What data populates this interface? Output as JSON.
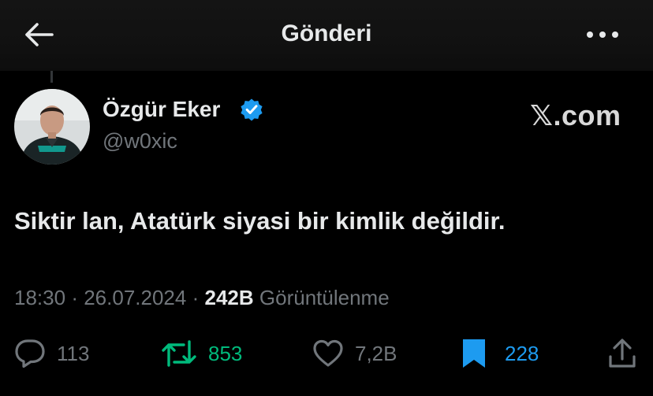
{
  "header": {
    "title": "Gönderi"
  },
  "post": {
    "author": {
      "name": "Özgür Eker",
      "handle": "@w0xic",
      "verified": true
    },
    "watermark": "𝕏.com",
    "text": "Siktir lan, Atatürk siyasi bir kimlik değildir.",
    "time": "18:30",
    "separator": "·",
    "date": "26.07.2024",
    "views": "242B",
    "views_label": "Görüntülenme"
  },
  "actions": {
    "replies": "113",
    "reposts": "853",
    "likes": "7,2B",
    "bookmarks": "228"
  },
  "colors": {
    "background": "#000000",
    "text": "#e7e9ea",
    "muted": "#71767b",
    "verified": "#1d9bf0",
    "repost": "#00ba7c",
    "bookmark": "#1d9bf0"
  }
}
